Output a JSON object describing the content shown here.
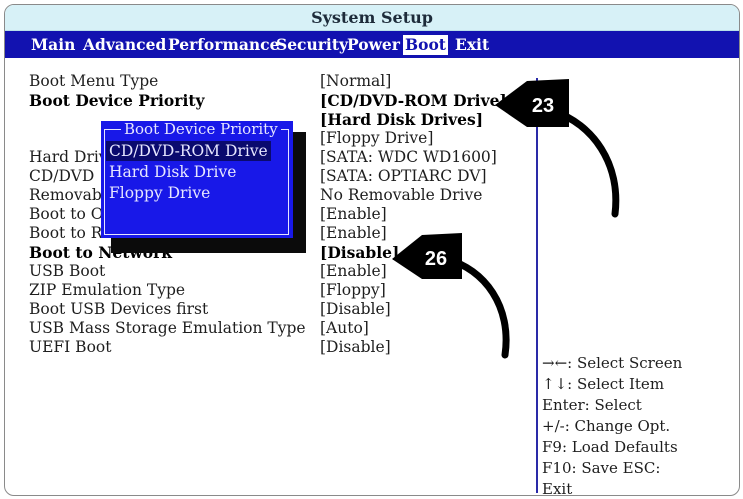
{
  "window": {
    "title": "System Setup"
  },
  "menu": {
    "items": [
      "Main",
      "Advanced",
      "Performance",
      "Security",
      "Power",
      "Boot",
      "Exit"
    ],
    "active": "Boot"
  },
  "settings": [
    {
      "label": "Boot Menu Type",
      "value": "[Normal]"
    },
    {
      "label": "Boot Device Priority",
      "value": "[CD/DVD-ROM Drive]",
      "value2": "[Hard Disk Drives]",
      "value3": "[Floppy Drive]"
    },
    {
      "label": "Hard Drive",
      "value": "[SATA:  WDC WD1600]"
    },
    {
      "label": "CD/DVD",
      "value": "[SATA:  OPTIARC DV]"
    },
    {
      "label": "Removable",
      "value": "No Removable Drive"
    },
    {
      "label": "Boot to O",
      "value": "[Enable]"
    },
    {
      "label": "Boot to Re",
      "value": "[Enable]"
    },
    {
      "label": "Boot to Network",
      "value": "[Disable]"
    },
    {
      "label": "USB Boot",
      "value": "[Enable]"
    },
    {
      "label": "ZIP Emulation Type",
      "value": "[Floppy]"
    },
    {
      "label": "Boot USB Devices first",
      "value": "[Disable]"
    },
    {
      "label": "USB Mass Storage Emulation Type",
      "value": "[Auto]"
    },
    {
      "label": "UEFI Boot",
      "value": "[Disable]"
    }
  ],
  "popup": {
    "title": "Boot Device Priority",
    "options": [
      "CD/DVD-ROM Drive",
      "Hard Disk Drive",
      "Floppy Drive"
    ],
    "selected": "CD/DVD-ROM Drive"
  },
  "help": {
    "select_screen": "→←:  Select Screen",
    "select_item": "↑↓:  Select Item",
    "enter": "Enter:  Select",
    "change": "+/-:  Change Opt.",
    "f9": "F9:  Load Defaults",
    "f10": "F10:  Save  ESC:",
    "exit": "Exit"
  },
  "callouts": [
    "23",
    "26"
  ],
  "colors": {
    "menubar": "#1212b0",
    "popup": "#1818e8",
    "titlebar": "#d7f1f7"
  }
}
